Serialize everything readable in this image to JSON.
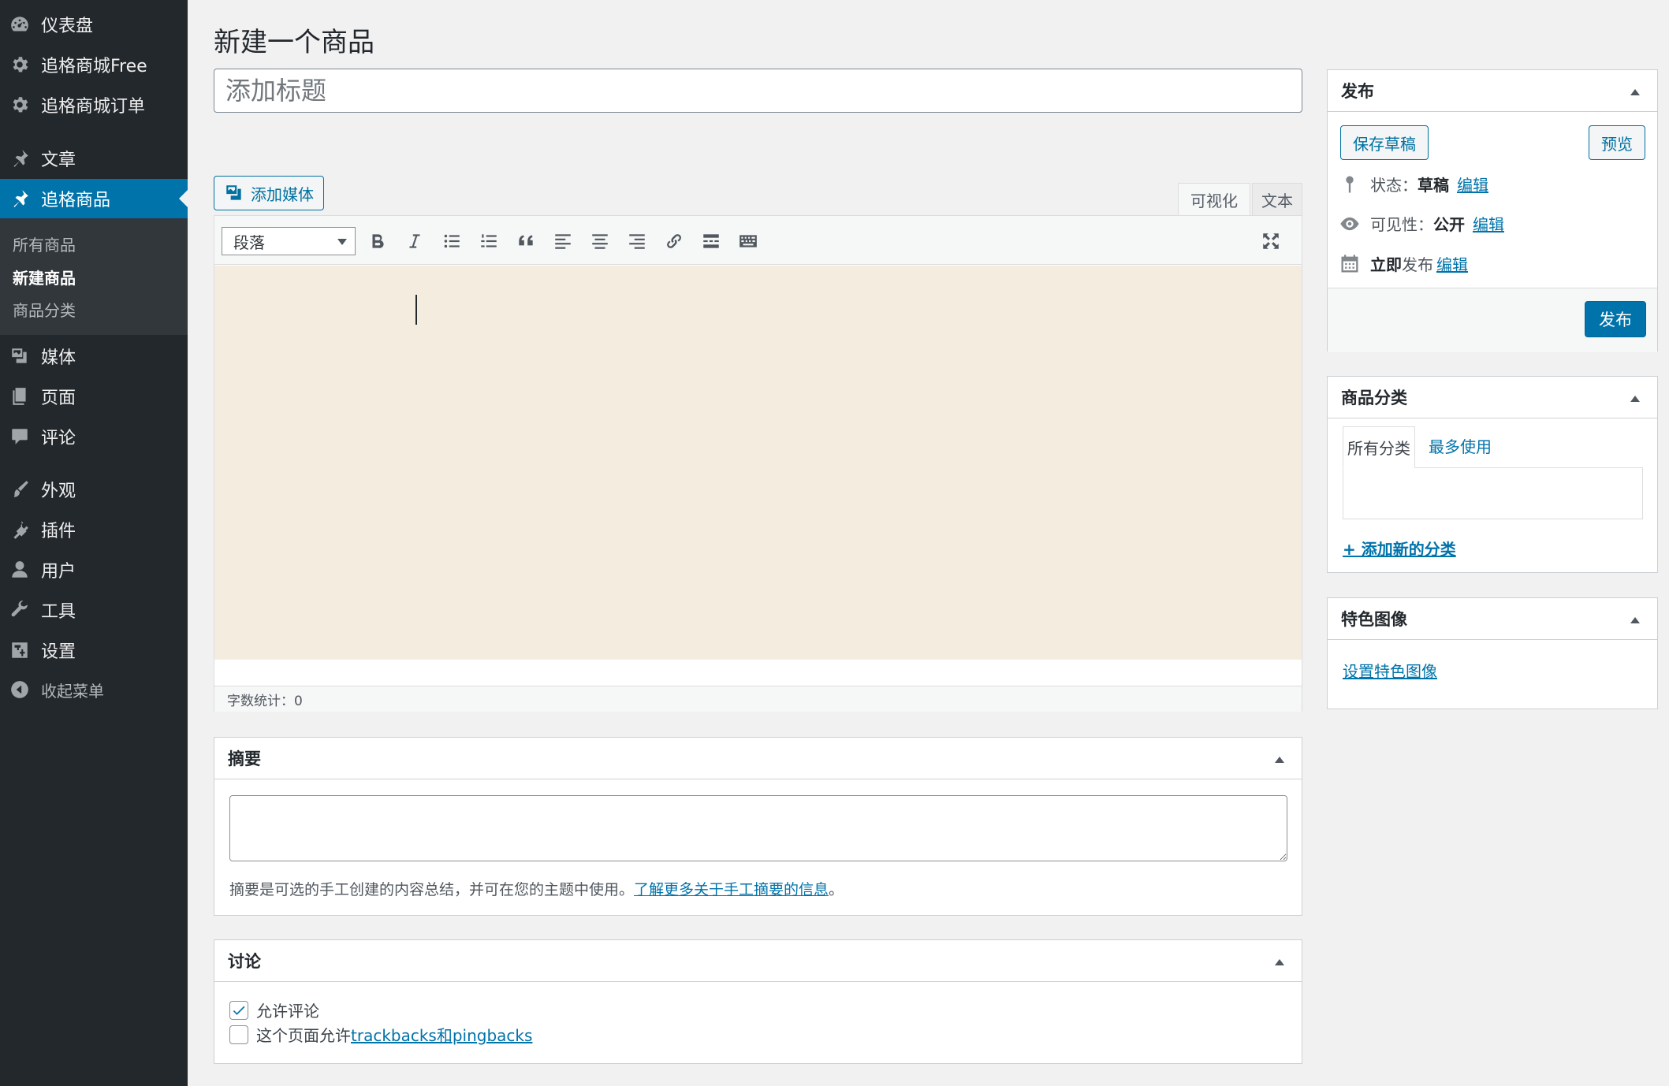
{
  "sidebar": {
    "items": [
      {
        "label": "仪表盘",
        "icon": "dashboard-icon"
      },
      {
        "label": "追格商城Free",
        "icon": "gear-icon"
      },
      {
        "label": "追格商城订单",
        "icon": "gear-icon"
      },
      {
        "label": "文章",
        "icon": "pin-icon"
      },
      {
        "label": "追格商品",
        "icon": "pin-icon",
        "active": true
      },
      {
        "label": "媒体",
        "icon": "media-icon"
      },
      {
        "label": "页面",
        "icon": "page-icon"
      },
      {
        "label": "评论",
        "icon": "comment-icon"
      },
      {
        "label": "外观",
        "icon": "brush-icon"
      },
      {
        "label": "插件",
        "icon": "plugin-icon"
      },
      {
        "label": "用户",
        "icon": "user-icon"
      },
      {
        "label": "工具",
        "icon": "wrench-icon"
      },
      {
        "label": "设置",
        "icon": "settings-icon"
      },
      {
        "label": "收起菜单",
        "icon": "collapse-icon"
      }
    ],
    "submenu": [
      {
        "label": "所有商品"
      },
      {
        "label": "新建商品",
        "current": true
      },
      {
        "label": "商品分类"
      }
    ]
  },
  "main": {
    "page_title": "新建一个商品",
    "title_placeholder": "添加标题",
    "add_media_label": "添加媒体",
    "editor_tabs": {
      "visual": "可视化",
      "text": "文本"
    },
    "format_select_value": "段落",
    "word_count": "字数统计：0"
  },
  "excerpt": {
    "title": "摘要",
    "help_text": "摘要是可选的手工创建的内容总结，并可在您的主题中使用。",
    "help_link": "了解更多关于手工摘要的信息",
    "help_suffix": "。"
  },
  "discussion": {
    "title": "讨论",
    "allow_comments": {
      "label": "允许评论",
      "checked": true
    },
    "allow_pings": {
      "label_prefix": "这个页面允许",
      "link": "trackbacks和pingbacks",
      "checked": false
    }
  },
  "publish": {
    "title": "发布",
    "save_draft": "保存草稿",
    "preview": "预览",
    "status_label": "状态：",
    "status_value": "草稿",
    "visibility_label": "可见性：",
    "visibility_value": "公开",
    "schedule_bold": "立即",
    "schedule_label": "发布",
    "edit_link": "编辑",
    "publish_button": "发布"
  },
  "categories": {
    "title": "商品分类",
    "tab_all": "所有分类",
    "tab_popular": "最多使用",
    "add_new": "+ 添加新的分类"
  },
  "featured_image": {
    "title": "特色图像",
    "set_link": "设置特色图像"
  },
  "colors": {
    "accent": "#0073aa",
    "sidebar": "#23282d",
    "editor_bg": "#f4eddf"
  }
}
